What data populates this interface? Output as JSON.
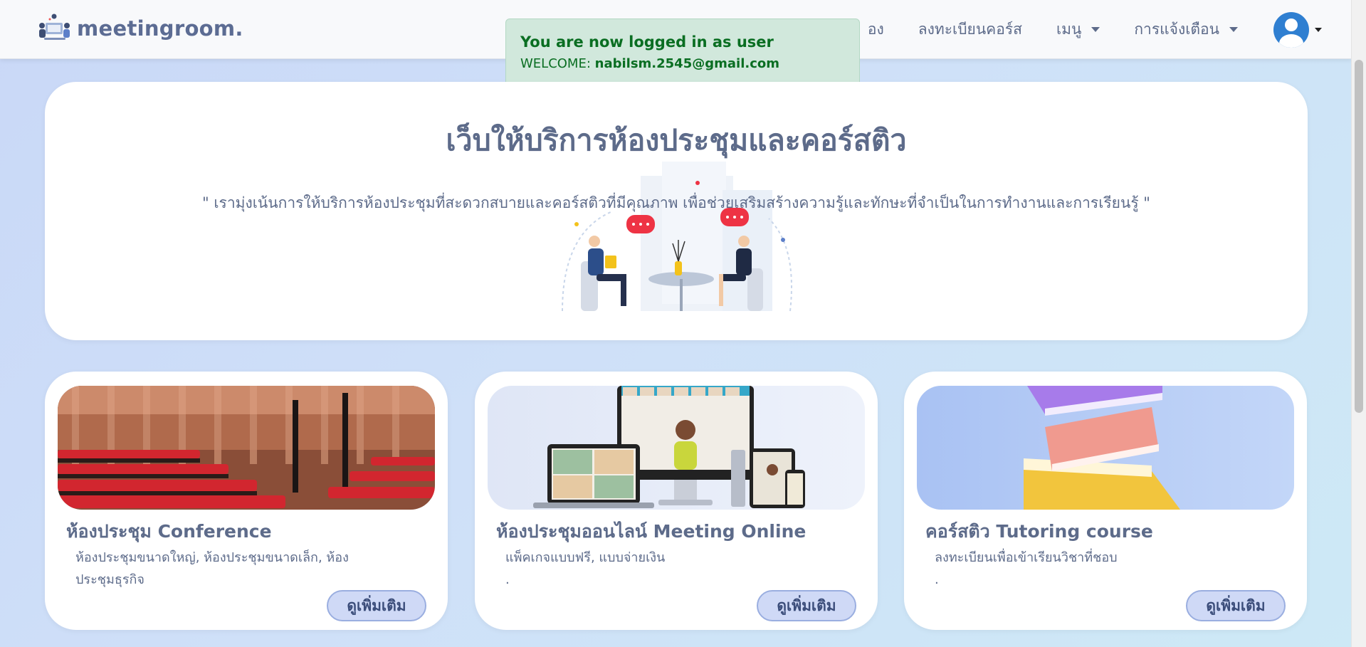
{
  "brand": {
    "name": "meetingroom."
  },
  "nav": {
    "items": [
      {
        "label": "อง",
        "dropdown": false
      },
      {
        "label": "ลงทะเบียนคอร์ส",
        "dropdown": false
      },
      {
        "label": "เมนู",
        "dropdown": true
      },
      {
        "label": "การแจ้งเตือน",
        "dropdown": true
      }
    ],
    "avatar_icon": "user-circle-icon"
  },
  "toast": {
    "title": "You are now logged in as user",
    "welcome_label": "WELCOME:",
    "email": "nabilsm.2545@gmail.com"
  },
  "hero": {
    "title": "เว็บให้บริการห้องประชุมและคอร์สติว",
    "quote": "\" เรามุ่งเน้นการให้บริการห้องประชุมที่สะดวกสบายและคอร์สติวที่มีคุณภาพ เพื่อช่วยเสริมสร้างความรู้และทักษะที่จำเป็นในการทำงานและการเรียนรู้ \""
  },
  "cards": [
    {
      "title": "ห้องประชุม Conference",
      "desc": "ห้องประชุมขนาดใหญ่, ห้องประชุมขนาดเล็ก, ห้องประชุมธุรกิจ",
      "button": "ดูเพิ่มเติม"
    },
    {
      "title": "ห้องประชุมออนไลน์ Meeting Online",
      "desc": "แพ็คเกจแบบฟรี, แบบจ่ายเงิน",
      "desc2": ".",
      "button": "ดูเพิ่มเติม"
    },
    {
      "title": "คอร์สติว Tutoring course",
      "desc": "ลงทะเบียนเพื่อเข้าเรียนวิชาที่ชอบ",
      "desc2": ".",
      "button": "ดูเพิ่มเติม"
    }
  ],
  "colors": {
    "accent": "#5d6b8a",
    "toast_bg": "#d1e8dc",
    "toast_text": "#0a6e22",
    "button_bg": "#cfd9f6"
  }
}
